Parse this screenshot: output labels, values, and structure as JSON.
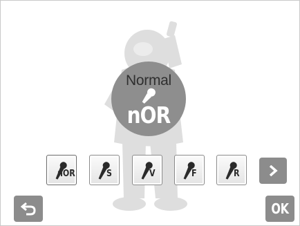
{
  "selected_mode": {
    "name": "Normal",
    "code": "nOR",
    "icon": "microphone-icon"
  },
  "voice_options": [
    {
      "label": "nOR",
      "icon": "microphone-icon",
      "selected": true
    },
    {
      "label": "S",
      "icon": "microphone-icon",
      "selected": false
    },
    {
      "label": "V",
      "icon": "microphone-icon",
      "selected": false
    },
    {
      "label": "F",
      "icon": "microphone-icon",
      "selected": false
    },
    {
      "label": "R",
      "icon": "microphone-icon",
      "selected": false
    }
  ],
  "buttons": {
    "next": {
      "icon": "chevron-right-icon"
    },
    "back": {
      "icon": "return-arrow-icon"
    },
    "ok": {
      "label": "OK"
    }
  },
  "colors": {
    "button_gray": "#8c8c8c",
    "badge_gray": "#8e8e8e",
    "figure_gray": "#dcdcdc"
  }
}
